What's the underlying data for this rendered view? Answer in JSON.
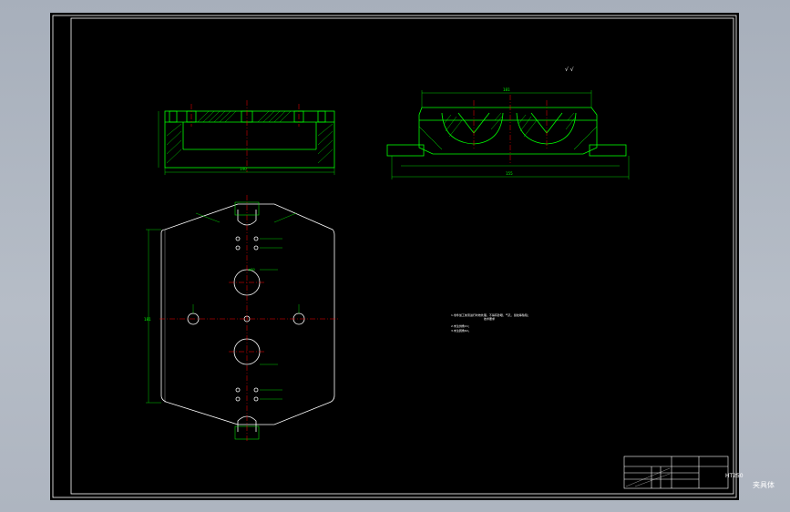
{
  "sheet": {
    "background": "#000000",
    "line_color": "#ffffff"
  },
  "colors": {
    "outline": "#00ff00",
    "centerline": "#ff0000",
    "dimension": "#ff00ff",
    "hatch": "#00ff00"
  },
  "dimensions": {
    "top_overall": "181",
    "side_overall": "181",
    "side_width": "155",
    "front_width": "140",
    "left_height": "181",
    "bore": "φ30"
  },
  "notes": {
    "title": "技术要求",
    "line1": "1.零件加工前须进行时效处理，不得有砂眼、气孔、裂纹等缺陷；",
    "line2": "2.未注倒角C1；",
    "line3": "3.未注圆角R2。"
  },
  "title_block": {
    "material": "HT250",
    "part_name": "夹具体"
  }
}
